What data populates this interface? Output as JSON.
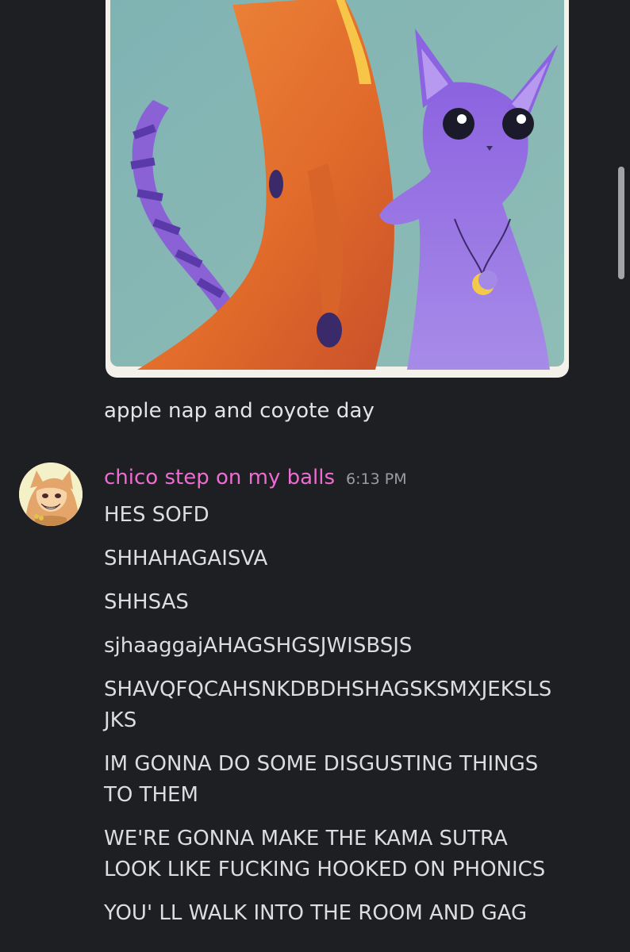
{
  "attachment": {
    "caption": "apple nap and coyote day"
  },
  "message_group": {
    "username": "chico step on my balls",
    "timestamp": "6:13 PM",
    "messages": [
      "HES SOFD",
      "SHHAHAGAISVA",
      "SHHSAS",
      "sjhaaggajAHAGSHGSJWISBSJS",
      "SHAVQFQCAHSNKDBDHSHAGSKSMXJEKSLS\nJKS",
      "IM GONNA DO SOME DISGUSTING THINGS\nTO THEM",
      "WE'RE GONNA MAKE THE KAMA SUTRA\nLOOK LIKE FUCKING HOOKED ON PHONICS",
      "YOU' LL WALK INTO THE ROOM AND GAG"
    ]
  },
  "colors": {
    "background": "#1e1f23",
    "username": "#ee6cd2",
    "text": "#dcdde1",
    "timestamp": "#9a9ca3"
  }
}
